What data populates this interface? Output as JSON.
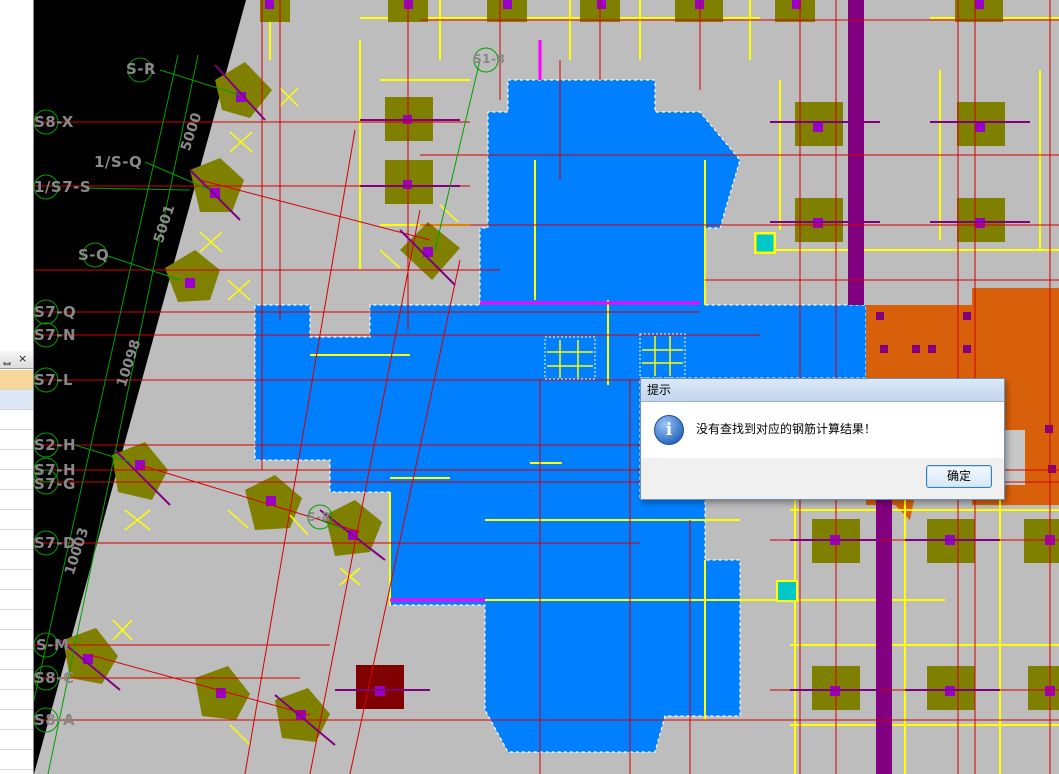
{
  "dialog": {
    "title": "提示",
    "message": "没有查找到对应的钢筋计算结果！",
    "ok_label": "确定",
    "icon": "info-icon"
  },
  "left_panel": {
    "pin_glyph": "ᆸ",
    "close_glyph": "×"
  },
  "axis_labels": {
    "s_r": "S-R",
    "s8_x": "S8-X",
    "one_s_q": "1/S-Q",
    "s7_s": "1/S7-S",
    "s_q": "S-Q",
    "s7_q": "S7-Q",
    "s7_n": "S7-N",
    "s7_l": "S7-L",
    "s7_h": "S7-H",
    "s7_g": "S7-G",
    "s7_d": "S7-D",
    "s_m": "S-M",
    "s8_c": "S8-C",
    "s8_a": "S8-A",
    "s2_h": "S2-H",
    "s1_8": "S1-8",
    "s_8": "S-8"
  },
  "dimensions": {
    "d1": "5000",
    "d2": "5001",
    "d3": "10098",
    "d4": "10003"
  },
  "colors": {
    "background": "#bdbdbd",
    "slab_blue": "#0080ff",
    "column_olive": "#808000",
    "column_core": "#9900cc",
    "beam_purple": "#800080",
    "wall_orange": "#d9600a",
    "rebar_yellow": "#ffff00",
    "axis_red": "#d40000",
    "dark_red_block": "#800000",
    "magenta": "#ff00ff"
  }
}
